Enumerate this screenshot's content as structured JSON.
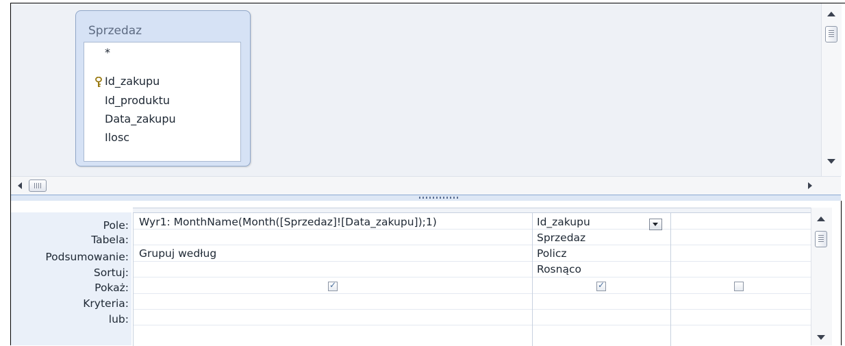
{
  "table_window": {
    "title": "Sprzedaz",
    "fields": [
      "*",
      "Id_zakupu",
      "Id_produktu",
      "Data_zakupu",
      "Ilosc"
    ],
    "primary_key_field": "Id_zakupu"
  },
  "row_labels": [
    "Pole:",
    "Tabela:",
    "Podsumowanie:",
    "Sortuj:",
    "Pokaż:",
    "Kryteria:",
    "lub:"
  ],
  "columns": [
    {
      "field": "Wyr1: MonthName(Month([Sprzedaz]![Data_zakupu]);1)",
      "table": "",
      "total": "Grupuj według",
      "sort": "",
      "show": true
    },
    {
      "field": "Id_zakupu",
      "table": "Sprzedaz",
      "total": "Policz",
      "sort": "Rosnąco",
      "show": true,
      "has_dropdown": true
    },
    {
      "field": "",
      "table": "",
      "total": "",
      "sort": "",
      "show": false
    }
  ],
  "icons": {
    "primary_key": "key-icon",
    "scroll_up": "arrow-up-icon",
    "scroll_down": "arrow-down-icon",
    "scroll_left": "arrow-left-icon",
    "scroll_right": "arrow-right-icon",
    "dropdown": "chevron-down-icon",
    "checkbox": "checkbox-icon"
  },
  "colors": {
    "pane_background": "#eef1f6",
    "table_window_header": "#d6e2f5",
    "row_label_background": "#eaf0f9",
    "checkmark": "#4a6e9c"
  }
}
